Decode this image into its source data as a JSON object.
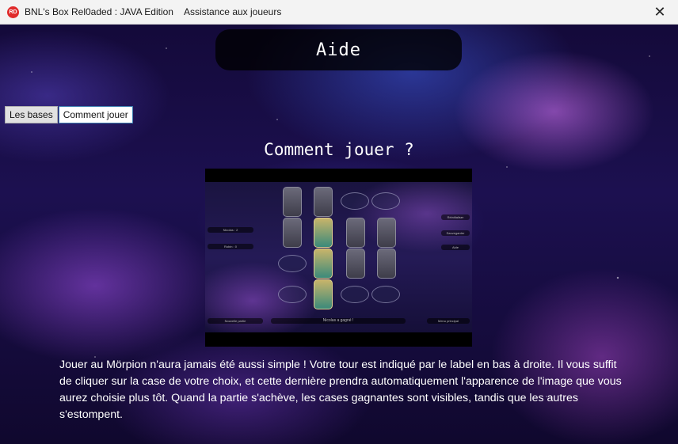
{
  "window": {
    "app_title": "BNL's Box Rel0aded : JAVA Edition",
    "subtitle": "Assistance aux joueurs",
    "app_icon_text": "RD",
    "close_symbol": "✕"
  },
  "header": {
    "title": "Aide"
  },
  "tabs": [
    {
      "label": "Les bases",
      "active": false
    },
    {
      "label": "Comment jouer",
      "active": true
    }
  ],
  "section": {
    "title": "Comment jouer ?",
    "description": "Jouer au Mörpion n'aura jamais été aussi simple ! Votre tour est indiqué par le label en bas à droite. Il vous suffit de cliquer sur la case de votre choix, et cette dernière prendra automatiquement l'apparence de l'image que vous aurez choisie plus tôt. Quand la partie s'achève, les cases gagnantes sont visibles, tandis que les autres s'estompent."
  },
  "preview": {
    "left_labels": [
      "Nicolas : 2",
      "Robin : 0"
    ],
    "right_labels": [
      "Réinitialiser",
      "Sauvegarder",
      "Aide"
    ],
    "bottom_left": "Nouvelle partie",
    "bottom_center": "Nicolas a gagné !",
    "bottom_right": "Menu principal"
  }
}
